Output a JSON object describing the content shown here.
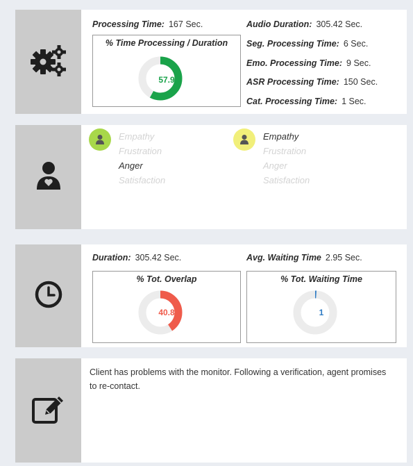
{
  "processing": {
    "processing_time_label": "Processing Time:",
    "processing_time_value": "167 Sec.",
    "audio_duration_label": "Audio Duration:",
    "audio_duration_value": "305.42 Sec.",
    "seg_label": "Seg. Processing Time:",
    "seg_value": "6 Sec.",
    "emo_label": "Emo. Processing Time:",
    "emo_value": "9 Sec.",
    "asr_label": "ASR Processing Time:",
    "asr_value": "150 Sec.",
    "cat_label": "Cat. Processing Time:",
    "cat_value": "1 Sec.",
    "ratio_title": "% Time Processing / Duration",
    "ratio_value": "57.9",
    "ratio_percent": 57.9,
    "ratio_color": "#1aa34a",
    "icon": "gears-icon"
  },
  "emotions": {
    "icon": "user-heart-icon",
    "speaker1": {
      "avatar_color": "#a8d84a",
      "items": [
        "Empathy",
        "Frustration",
        "Anger",
        "Satisfaction"
      ],
      "active": [
        false,
        false,
        true,
        false
      ]
    },
    "speaker2": {
      "avatar_color": "#f1ef7a",
      "items": [
        "Empathy",
        "Frustration",
        "Anger",
        "Satisfaction"
      ],
      "active": [
        true,
        false,
        false,
        false
      ]
    }
  },
  "timing": {
    "icon": "clock-icon",
    "duration_label": "Duration:",
    "duration_value": "305.42 Sec.",
    "wait_label": "Avg. Waiting Time",
    "wait_value": "2.95 Sec.",
    "overlap_title": "% Tot. Overlap",
    "overlap_value": "40.8",
    "overlap_percent": 40.8,
    "overlap_color": "#ef5b4b",
    "waiting_title": "% Tot. Waiting Time",
    "waiting_value": "1",
    "waiting_percent": 1,
    "waiting_color": "#2e7bc4"
  },
  "notes": {
    "icon": "edit-note-icon",
    "text": "Client has problems with the monitor. Following a verification, agent promises to re-contact."
  }
}
